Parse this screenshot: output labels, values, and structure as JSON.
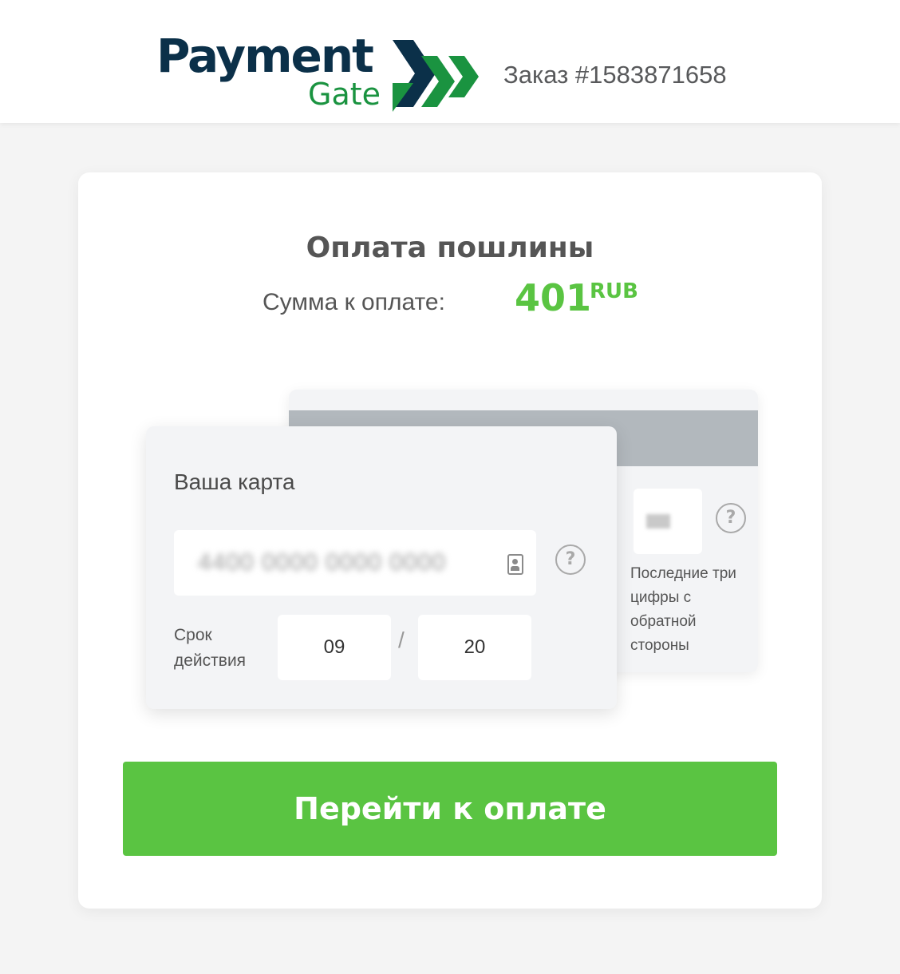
{
  "header": {
    "logo": {
      "word_main": "Payment",
      "word_sub": "Gate"
    },
    "order_label": "Заказ #1583871658"
  },
  "payment": {
    "title": "Оплата пошлины",
    "amount_label": "Сумма к оплате:",
    "amount_value": "401",
    "currency": "RUB"
  },
  "card_front": {
    "title": "Ваша карта",
    "card_number_masked": "4400 0000 0000 0000",
    "expiry_label": "Срок действия",
    "expiry_month": "09",
    "expiry_separator": "/",
    "expiry_year": "20"
  },
  "card_back": {
    "cvc_hint": "Последние три цифры с обратной стороны"
  },
  "pay_button": {
    "label": "Перейти к оплате"
  },
  "icons": {
    "help": "?",
    "logo_arrows": "chevron-arrows-icon",
    "card_scan": "card-scan-icon"
  },
  "colors": {
    "brand_navy": "#0b3049",
    "brand_green": "#1a9340",
    "accent_green": "#5ac442",
    "strip_gray": "#b2b8bd"
  }
}
